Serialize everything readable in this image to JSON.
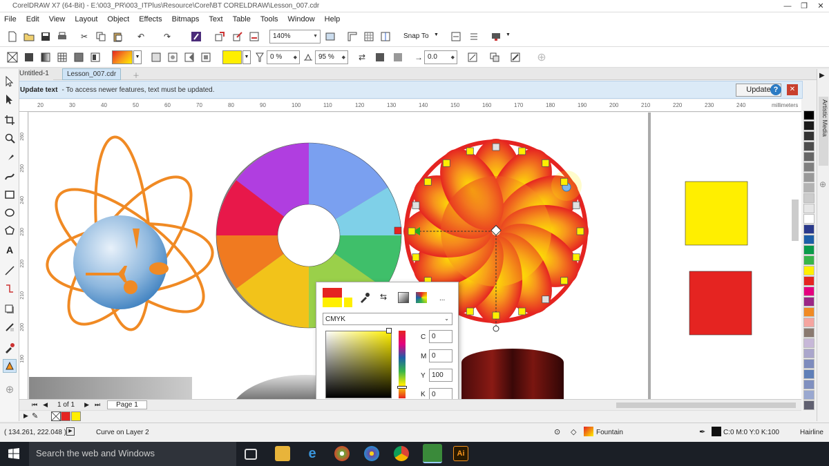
{
  "window": {
    "title": "CorelDRAW X7 (64-Bit) - E:\\003_PR\\003_ITPlus\\Resource\\Corel\\BT CORELDRAW\\Lesson_007.cdr",
    "min": "—",
    "restore": "❐",
    "close": "✕"
  },
  "menu": [
    "File",
    "Edit",
    "View",
    "Layout",
    "Object",
    "Effects",
    "Bitmaps",
    "Text",
    "Table",
    "Tools",
    "Window",
    "Help"
  ],
  "toolbar1": {
    "zoom": "140%",
    "snap": "Snap To"
  },
  "toolbar2": {
    "transparency_pct": "0 %",
    "node_pct": "95 %",
    "angle": "0.0"
  },
  "tabs": [
    "Untitled-1",
    "Lesson_007.cdr"
  ],
  "notification": {
    "title": "Update text",
    "message": "-  To access newer features, text must be updated.",
    "button": "Update"
  },
  "ruler": {
    "unit": "millimeters",
    "h_ticks": [
      "20",
      "30",
      "40",
      "50",
      "60",
      "70",
      "80",
      "90",
      "100",
      "110",
      "120",
      "130",
      "140",
      "150",
      "160",
      "170",
      "180",
      "190",
      "200",
      "210",
      "220",
      "230",
      "240"
    ],
    "v_ticks": [
      "260",
      "250",
      "240",
      "230",
      "220",
      "210",
      "200",
      "190"
    ]
  },
  "page_nav": {
    "position": "1 of 1",
    "page_tab": "Page 1"
  },
  "color_popup": {
    "model": "CMYK",
    "c_label": "C",
    "m_label": "M",
    "y_label": "Y",
    "k_label": "K",
    "c": "0",
    "m": "0",
    "y": "100",
    "k": "0",
    "more": "..."
  },
  "status": {
    "coords": "( 134.261, 222.048 )",
    "object": "Curve on Layer 2",
    "fill_label": "Fountain",
    "outline_color": "C:0 M:0 Y:0 K:100",
    "outline_width": "Hairline"
  },
  "taskbar": {
    "search": "Search the web and Windows"
  },
  "colors": {
    "accent_blue": "#2a7bc4",
    "palette": [
      "#000000",
      "#1a1a1a",
      "#333333",
      "#4d4d4d",
      "#666666",
      "#808080",
      "#999999",
      "#b3b3b3",
      "#cccccc",
      "#e6e6e6",
      "#ffffff",
      "#2a3a8c",
      "#1d5fa8",
      "#0b9b4a",
      "#38b54a",
      "#ffef00",
      "#e52421",
      "#e4007f",
      "#9b2686",
      "#f08a24",
      "#f5a5a0",
      "#8a7a70",
      "#c7b8d8",
      "#aaa6cc",
      "#7d8bbd",
      "#5f7fb8",
      "#8090c0",
      "#9aa8d0",
      "#606070"
    ]
  }
}
